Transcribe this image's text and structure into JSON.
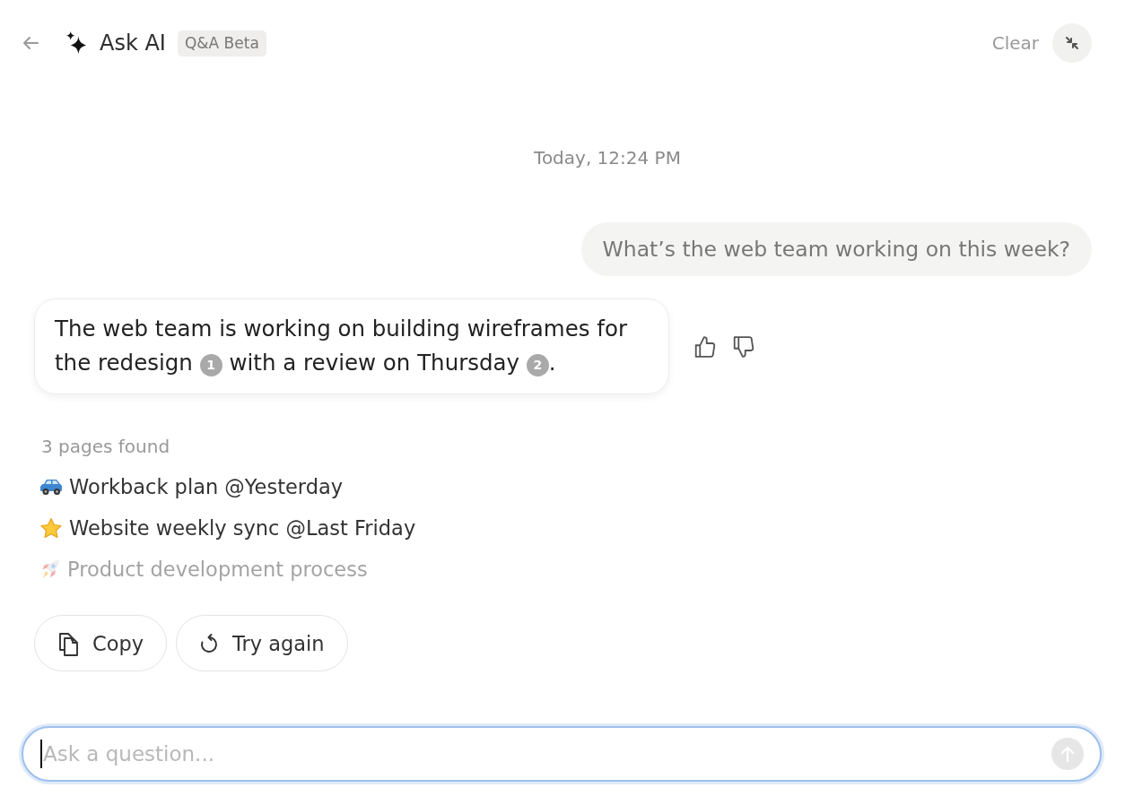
{
  "header": {
    "title": "Ask AI",
    "badge": "Q&A Beta",
    "clear_label": "Clear"
  },
  "timestamp": "Today, 12:24 PM",
  "user_message": {
    "text": "What’s the web team working on this week?"
  },
  "answer": {
    "segments": [
      {
        "kind": "text",
        "text": "The web team is working on building wireframes for the redesign "
      },
      {
        "kind": "citation",
        "text": "1"
      },
      {
        "kind": "text",
        "text": " with a review on Thursday "
      },
      {
        "kind": "citation",
        "text": "2"
      },
      {
        "kind": "text",
        "text": "."
      }
    ]
  },
  "sources": {
    "summary": "3 pages found",
    "pages": [
      {
        "title": "Workback plan @Yesterday",
        "dimmed": false
      },
      {
        "title": "Website weekly sync @Last Friday",
        "dimmed": false
      },
      {
        "title": "Product development process",
        "dimmed": true
      }
    ]
  },
  "actions": [
    {
      "kind": "copy",
      "label": "Copy"
    },
    {
      "kind": "retry",
      "label": "Try again"
    }
  ],
  "input": {
    "placeholder": "Ask a question...",
    "focused": true,
    "send_disabled": true
  }
}
